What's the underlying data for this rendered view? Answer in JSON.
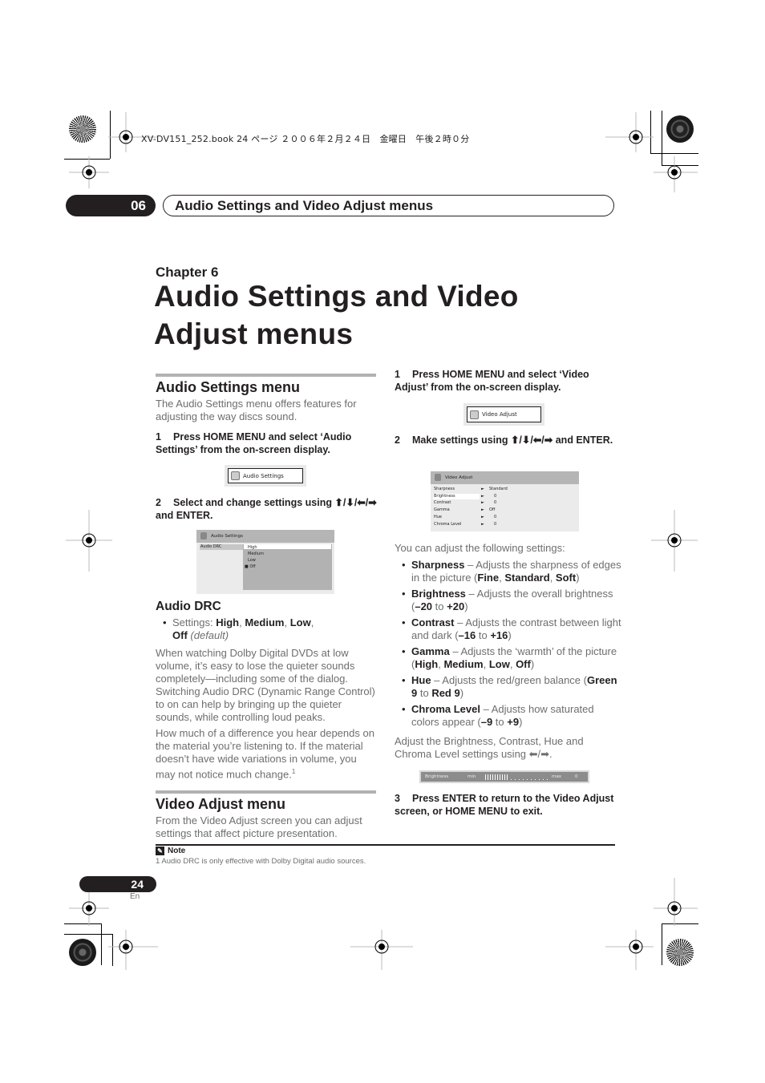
{
  "print_header": "XV-DV151_252.book  24 ページ  ２００６年２月２４日　金曜日　午後２時０分",
  "chapter_tab": {
    "number": "06",
    "title": "Audio Settings and Video Adjust menus"
  },
  "chapter": {
    "label": "Chapter 6",
    "title_line1": "Audio Settings and Video",
    "title_line2": "Adjust menus"
  },
  "audio_section": {
    "heading": "Audio Settings menu",
    "intro": "The Audio Settings menu offers features for adjusting the way discs sound.",
    "step1": {
      "num": "1",
      "text": "Press HOME MENU and select ‘Audio Settings’ from the on-screen display."
    },
    "osd_button": {
      "icon": "speaker-icon",
      "label": "Audio Settings"
    },
    "step2": {
      "num": "2",
      "text": "Select and change settings using ⬆/⬇/⬅/➡ and ENTER."
    },
    "osd_menu": {
      "title": "Audio Settings",
      "item": "Audio DRC",
      "options": [
        "High",
        "Medium",
        "Low",
        "Off"
      ],
      "highlighted": "High",
      "current": "Off"
    },
    "drc": {
      "heading": "Audio DRC",
      "settings_prefix": "Settings: ",
      "settings": [
        "High",
        "Medium",
        "Low",
        "Off"
      ],
      "default_note": "(default)",
      "para1": "When watching Dolby Digital DVDs at low volume, it’s easy to lose the quieter sounds completely—including some of the dialog. Switching Audio DRC (Dynamic Range Control) to on can help by bringing up the quieter sounds, while controlling loud peaks.",
      "para2": "How much of a difference you hear depends on the material you’re listening to. If the material doesn’t have wide variations in volume, you may not notice much change.",
      "footnote_ref": "1"
    }
  },
  "video_section": {
    "heading": "Video Adjust menu",
    "intro": "From the Video Adjust screen you can adjust settings that affect picture presentation.",
    "step1": {
      "num": "1",
      "text": "Press HOME MENU and select ‘Video Adjust’ from the on-screen display."
    },
    "osd_button": {
      "icon": "tv-icon",
      "label": "Video Adjust"
    },
    "step2": {
      "num": "2",
      "text": "Make settings using ⬆/⬇/⬅/➡ and ENTER."
    },
    "osd_menu": {
      "title": "Video Adjust",
      "rows": [
        {
          "name": "Sharpness",
          "value": "Standard"
        },
        {
          "name": "Brightness",
          "value": "0"
        },
        {
          "name": "Contrast",
          "value": "0"
        },
        {
          "name": "Gamma",
          "value": "Off"
        },
        {
          "name": "Hue",
          "value": "0"
        },
        {
          "name": "Chroma Level",
          "value": "0"
        }
      ],
      "highlighted": "Brightness"
    },
    "list_intro": "You can adjust the following settings:",
    "settings": [
      {
        "name": "Sharpness",
        "desc": " – Adjusts the sharpness of edges in the picture (",
        "range": [
          "Fine",
          "Standard",
          "Soft"
        ],
        "end": ")"
      },
      {
        "name": "Brightness",
        "desc": " – Adjusts the overall brightness (",
        "from": "–20",
        "to": "+20"
      },
      {
        "name": "Contrast",
        "desc": " – Adjusts the contrast between light and dark (",
        "from": "–16",
        "to": "+16"
      },
      {
        "name": "Gamma",
        "desc": " – Adjusts the ‘warmth’ of the picture (",
        "range": [
          "High",
          "Medium",
          "Low",
          "Off"
        ],
        "end": ")"
      },
      {
        "name": "Hue",
        "desc": " – Adjusts the red/green balance (",
        "from": "Green 9",
        "to": "Red 9"
      },
      {
        "name": "Chroma Level",
        "desc": " – Adjusts how saturated colors appear (",
        "from": "–9",
        "to": "+9"
      }
    ],
    "to_word": " to ",
    "adjust_note": "Adjust the Brightness, Contrast, Hue and Chroma Level settings using ⬅/➡.",
    "slider": {
      "label": "Brightness",
      "min_label": "min",
      "max_label": "max",
      "value": "0",
      "position_fraction": 0.5
    },
    "step3": {
      "num": "3",
      "text": "Press ENTER to return to the Video Adjust screen, or HOME MENU to exit."
    }
  },
  "note": {
    "heading": "Note",
    "text": "1 Audio DRC is only effective with Dolby Digital audio sources."
  },
  "page": {
    "number": "24",
    "lang": "En"
  }
}
